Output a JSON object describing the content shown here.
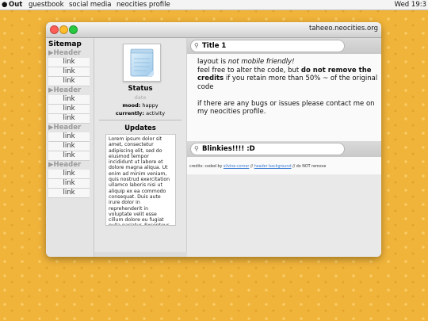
{
  "menubar": {
    "apple": "",
    "app_name": "Out",
    "items": [
      "guestbook",
      "social media",
      "neocities profile"
    ],
    "clock": "Wed 19:3"
  },
  "window": {
    "title": "taheeo.neocities.org"
  },
  "sitemap": {
    "title": "Sitemap",
    "sections": [
      {
        "header": "Header",
        "links": [
          "link",
          "link",
          "link"
        ]
      },
      {
        "header": "Header",
        "links": [
          "link",
          "link",
          "link"
        ]
      },
      {
        "header": "Header",
        "links": [
          "link",
          "link",
          "link"
        ]
      },
      {
        "header": "Header",
        "links": [
          "link",
          "link",
          "link"
        ]
      }
    ]
  },
  "profile": {
    "status_title": "Status",
    "date": "date",
    "mood_label": "mood:",
    "mood_value": "happy",
    "currently_label": "currently:",
    "currently_value": "activity",
    "updates_title": "Updates",
    "updates_text": "Lorem ipsum dolor sit amet, consectetur adipiscing elit, sed do eiusmod tempor incididunt ut labore et dolore magna aliqua. Ut enim ad minim veniam, quis nostrud exercitation ullamco laboris nisi ut aliquip ex ea commodo consequat. Duis aute irure dolor in reprehenderit in voluptate velit esse cillum dolore eu fugiat nulla pariatur. Excepteur sint"
  },
  "main": {
    "panel1_title": "Title 1",
    "p1_a": "layout is ",
    "p1_em": "not mobile friendly!",
    "p1_b": "feel free to alter the code, but ",
    "p1_strong": "do not remove the credits",
    "p1_c": " if you retain more than 50% ~ of the original code",
    "p2": "if there are any bugs or issues please contact me on my neocities profile.",
    "panel2_title": "Blinkies!!!! :D",
    "credits_a": "credits: coded by ",
    "credits_link1": "silvine-corner",
    "credits_sep": " // ",
    "credits_link2": "header background",
    "credits_b": " // do NOT remove"
  }
}
